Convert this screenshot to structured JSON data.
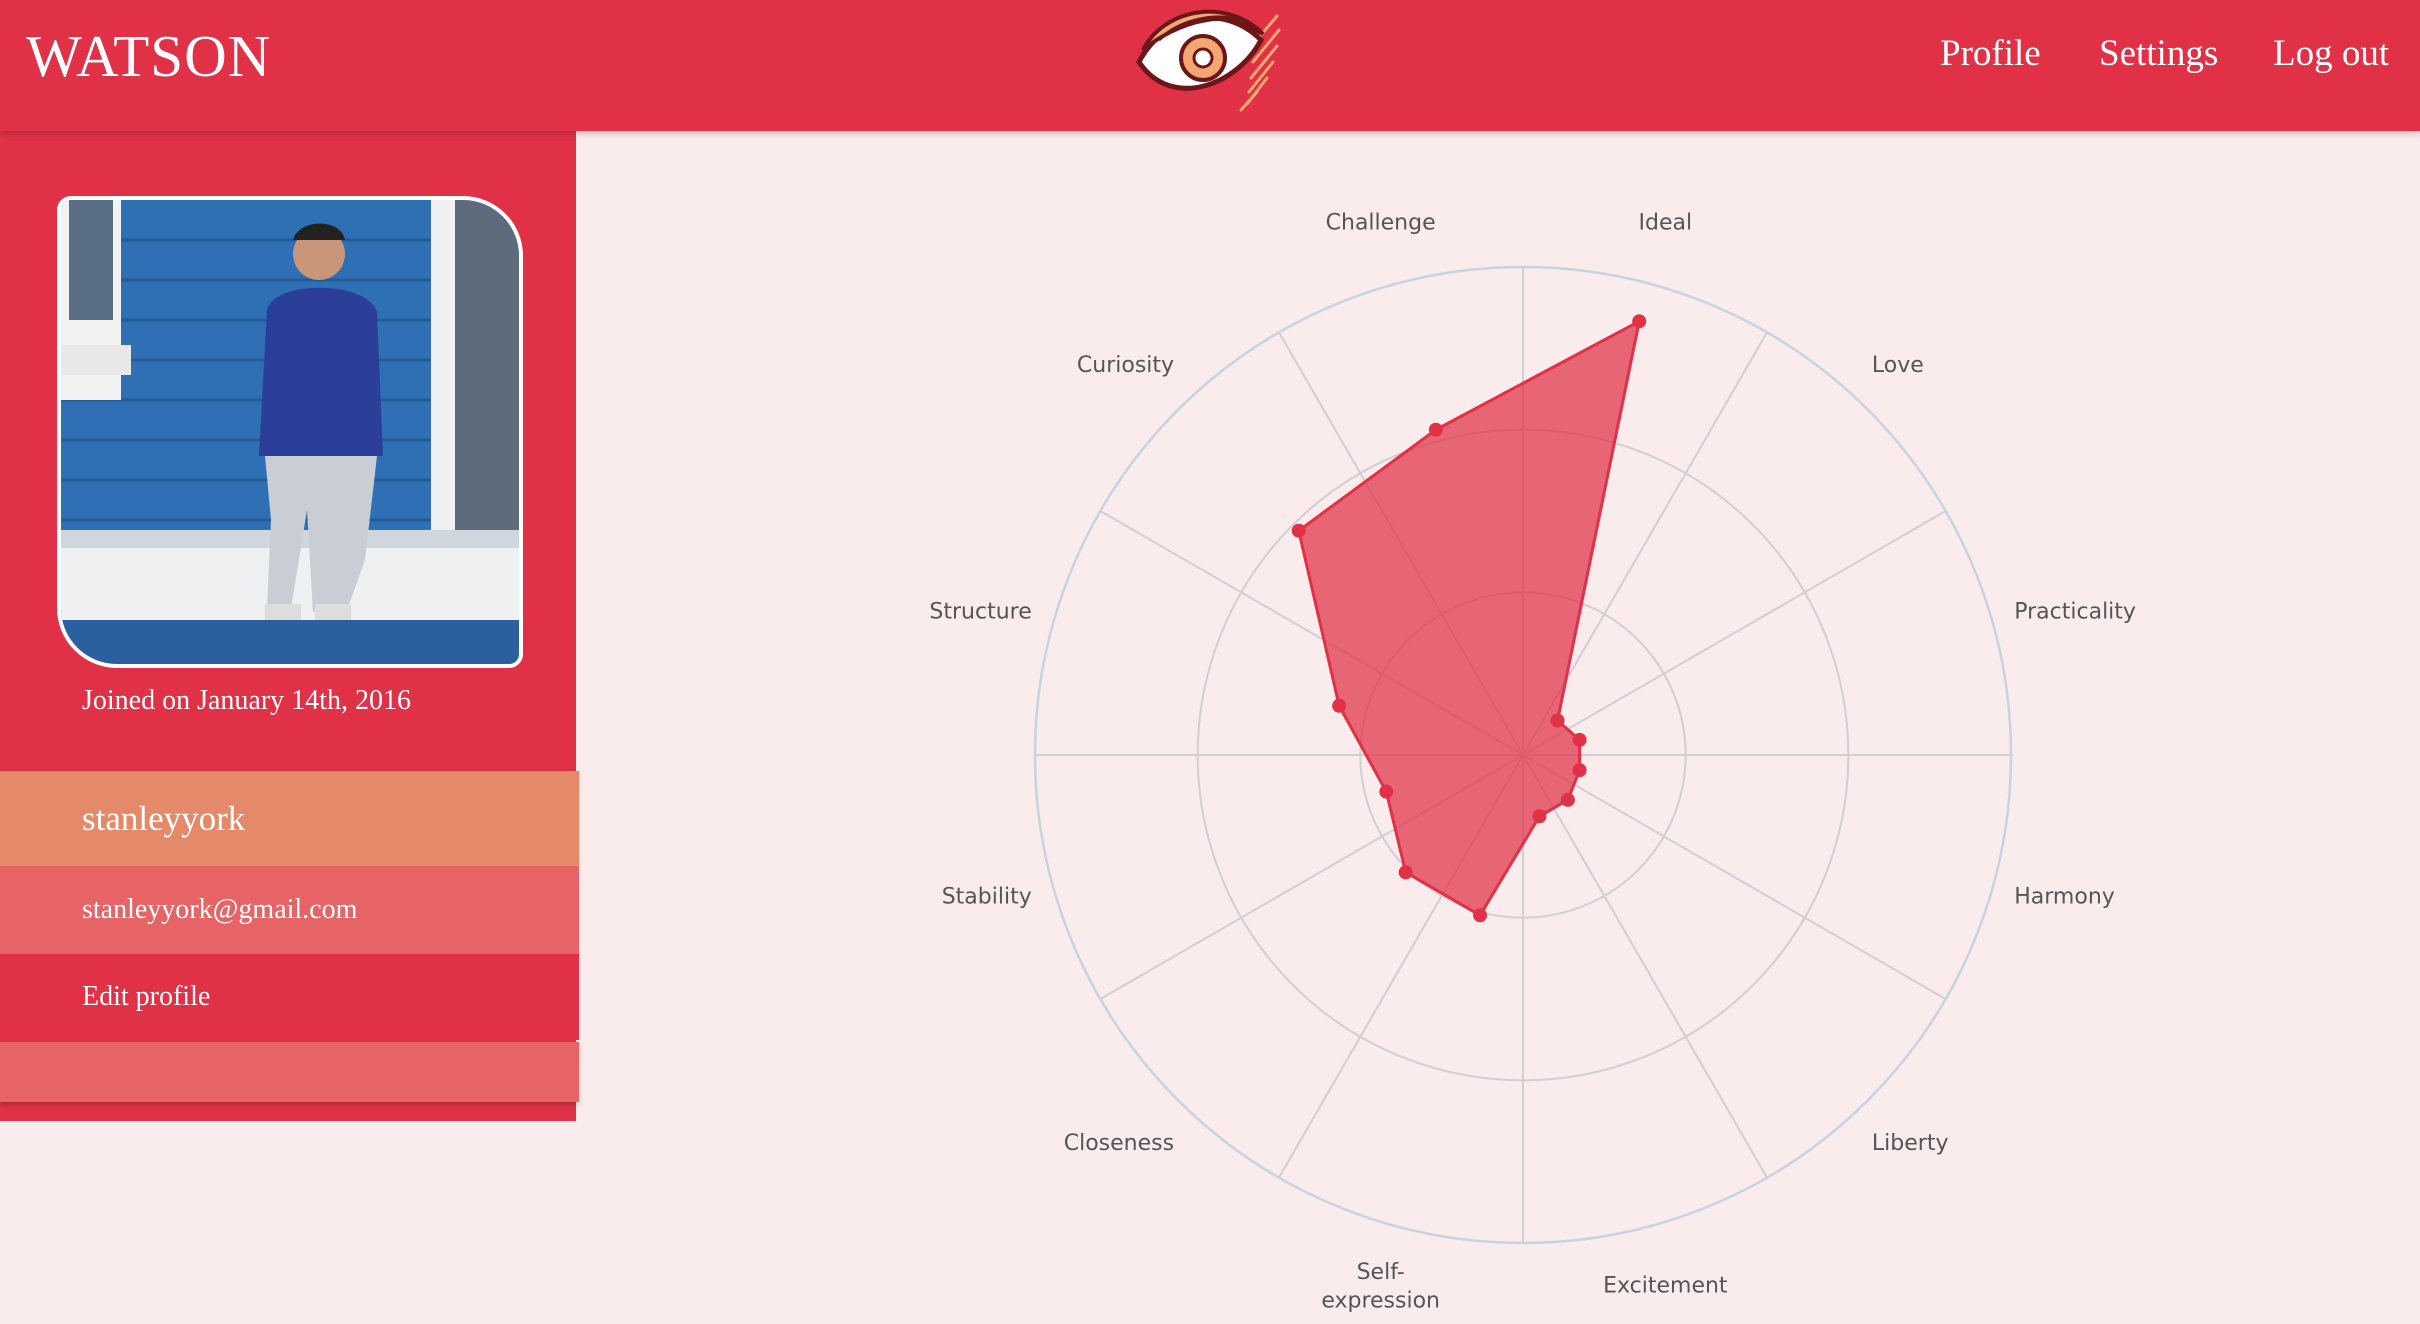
{
  "app": {
    "brand": "WATSON"
  },
  "nav": {
    "profile": "Profile",
    "settings": "Settings",
    "logout": "Log out"
  },
  "sidebar": {
    "joined": "Joined on January 14th, 2016",
    "username": "stanleyyork",
    "email": "stanleyyork@gmail.com",
    "edit_profile": "Edit profile"
  },
  "colors": {
    "accent": "#e03146",
    "background": "#faecec",
    "user_row": "#e48a6a",
    "email_row": "#e76466"
  },
  "chart_data": {
    "type": "radar",
    "categories": [
      "Ideal",
      "Love",
      "Practicality",
      "Harmony",
      "Liberty",
      "Excitement",
      "Self-expression",
      "Closeness",
      "Stability",
      "Structure",
      "Curiosity",
      "Challenge"
    ],
    "values": [
      0.92,
      0.1,
      0.12,
      0.12,
      0.13,
      0.13,
      0.34,
      0.34,
      0.29,
      0.39,
      0.65,
      0.69
    ],
    "range": [
      0,
      1
    ],
    "rings": 3
  }
}
